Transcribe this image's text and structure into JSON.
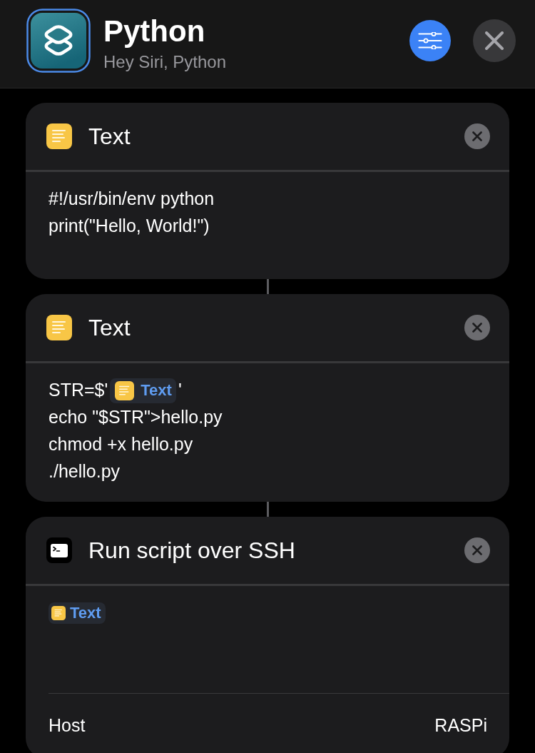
{
  "header": {
    "title": "Python",
    "subtitle": "Hey Siri, Python"
  },
  "actions": [
    {
      "kind": "text",
      "title": "Text",
      "lines": [
        [
          {
            "kind": "text",
            "value": "#!/usr/bin/env python"
          }
        ],
        [
          {
            "kind": "text",
            "value": "print(\"Hello, World!\")"
          }
        ]
      ]
    },
    {
      "kind": "text",
      "title": "Text",
      "lines": [
        [
          {
            "kind": "text",
            "value": "STR=$'"
          },
          {
            "kind": "variable",
            "label": "Text"
          },
          {
            "kind": "text",
            "value": "'"
          }
        ],
        [
          {
            "kind": "text",
            "value": "echo \"$STR\">hello.py"
          }
        ],
        [
          {
            "kind": "text",
            "value": "chmod +x hello.py"
          }
        ],
        [
          {
            "kind": "text",
            "value": "./hello.py"
          }
        ]
      ]
    },
    {
      "kind": "ssh",
      "title": "Run script over SSH",
      "lines": [
        [
          {
            "kind": "variable",
            "label": "Text"
          }
        ]
      ],
      "fields": [
        {
          "label": "Host",
          "value": "RASPi"
        }
      ]
    }
  ]
}
